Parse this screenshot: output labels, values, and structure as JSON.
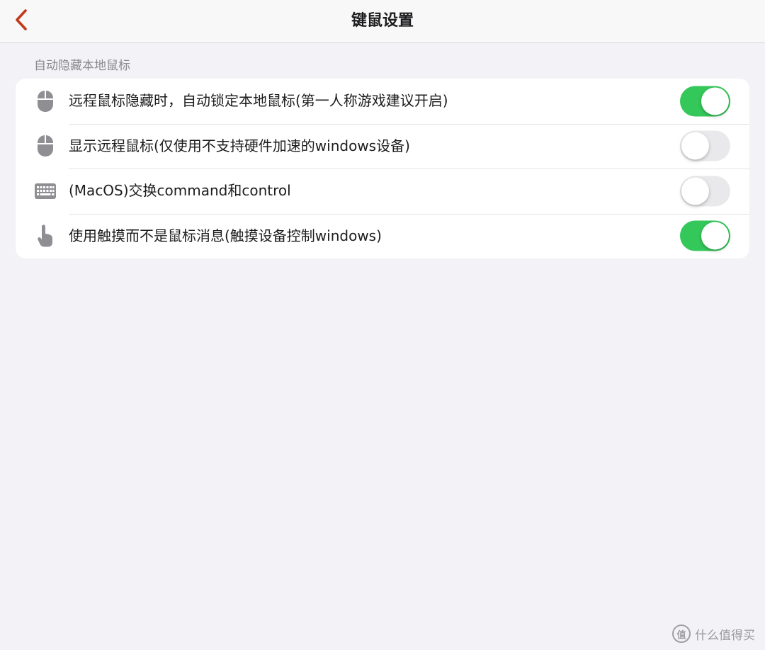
{
  "nav": {
    "title": "键鼠设置"
  },
  "section": {
    "header": "自动隐藏本地鼠标"
  },
  "rows": [
    {
      "icon": "mouse-icon",
      "label": "远程鼠标隐藏时，自动锁定本地鼠标(第一人称游戏建议开启)",
      "enabled": true
    },
    {
      "icon": "mouse-icon",
      "label": "显示远程鼠标(仅使用不支持硬件加速的windows设备)",
      "enabled": false
    },
    {
      "icon": "keyboard-icon",
      "label": "(MacOS)交换command和control",
      "enabled": false
    },
    {
      "icon": "touch-hand-icon",
      "label": "使用触摸而不是鼠标消息(触摸设备控制windows)",
      "enabled": true
    }
  ],
  "watermark": {
    "logo": "值",
    "text": "什么值得买"
  },
  "colors": {
    "accent_back": "#c0391c",
    "toggle_on": "#34c759",
    "toggle_off": "#e9e9eb",
    "icon_gray": "#8e8e93"
  }
}
